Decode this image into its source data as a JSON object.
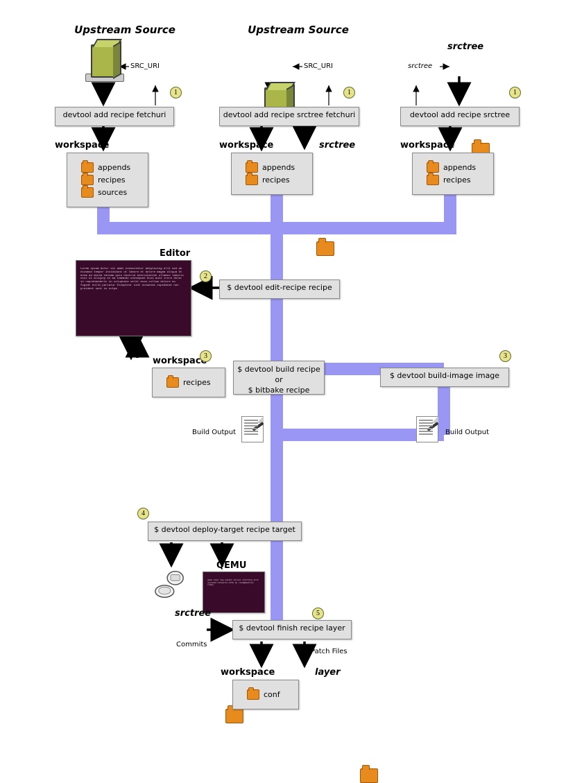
{
  "labels": {
    "upstream_source": "Upstream Source",
    "src_uri": "SRC_URI",
    "srctree": "srctree",
    "srctree_small": "srctree",
    "workspace": "workspace",
    "appends": "appends",
    "recipes": "recipes",
    "sources": "sources",
    "editor": "Editor",
    "build_output": "Build Output",
    "qemu": "QEMU",
    "commits": "Commits",
    "patch_files": "Patch Files",
    "layer": "layer",
    "conf": "conf"
  },
  "cmds": {
    "add1": "devtool add recipe fetchuri",
    "add2": "devtool add recipe srctree fetchuri",
    "add3": "devtool add recipe srctree",
    "edit": "$ devtool edit-recipe recipe",
    "build": "$ devtool build recipe\nor\n$ bitbake recipe",
    "build_image": "$ devtool build-image image",
    "deploy": "$ devtool deploy-target recipe target",
    "finish": "$ devtool finish recipe layer"
  },
  "steps": {
    "s1": "1",
    "s2": "2",
    "s3": "3",
    "s4": "4",
    "s5": "5"
  }
}
